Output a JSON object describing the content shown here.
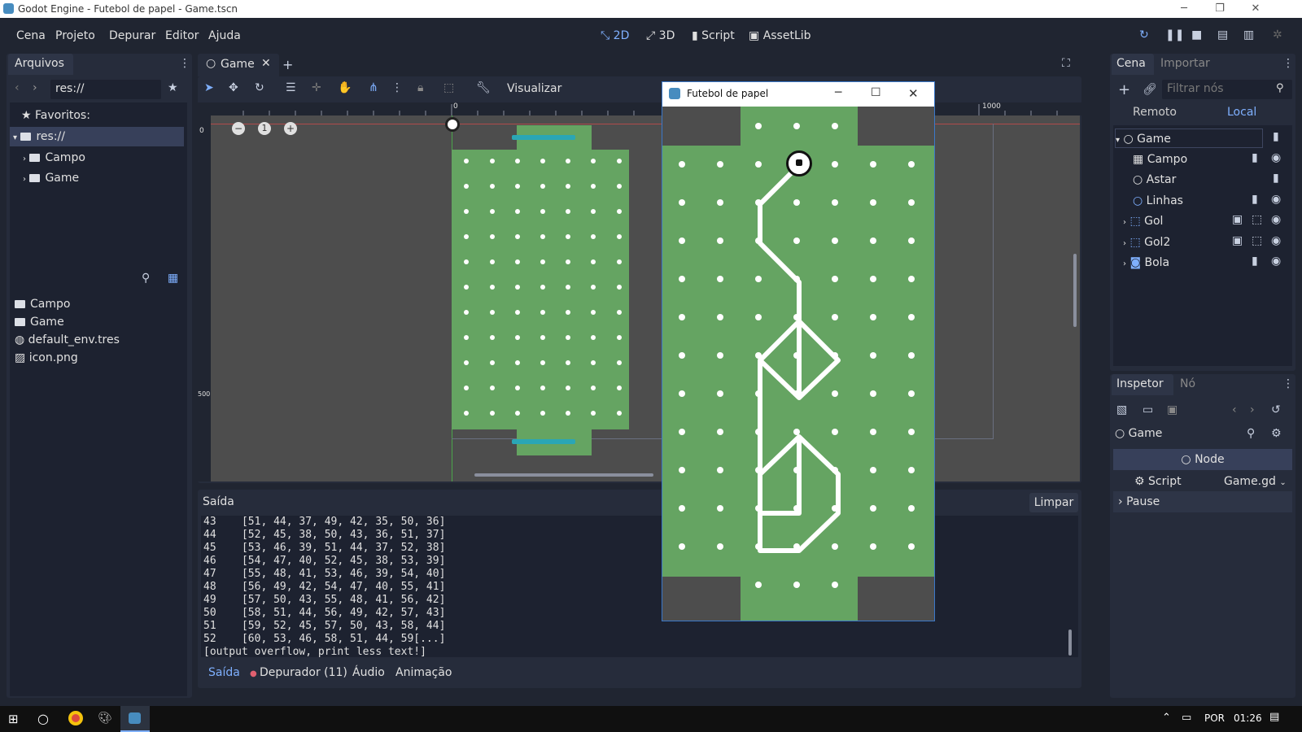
{
  "window": {
    "title": "Godot Engine - Futebol de papel - Game.tscn"
  },
  "menu": [
    "Cena",
    "Projeto",
    "Depurar",
    "Editor",
    "Ajuda"
  ],
  "modes": {
    "d2": "2D",
    "d3": "3D",
    "script": "Script",
    "assetlib": "AssetLib"
  },
  "filesystem": {
    "tab": "Arquivos",
    "path": "res://",
    "favorites": "Favoritos:",
    "tree": [
      "res://",
      "Campo",
      "Game"
    ],
    "files": [
      "Campo",
      "Game",
      "default_env.tres",
      "icon.png"
    ]
  },
  "viewport": {
    "tab": "Game",
    "view_menu": "Visualizar",
    "ruler": {
      "zero": "0",
      "thousand": "1000",
      "five_hundred": "500",
      "left_zero": "0"
    }
  },
  "game_window": {
    "title": "Futebol de papel"
  },
  "output": {
    "label": "Saída",
    "clear": "Limpar",
    "lines": [
      "43    [51, 44, 37, 49, 42, 35, 50, 36]",
      "44    [52, 45, 38, 50, 43, 36, 51, 37]",
      "45    [53, 46, 39, 51, 44, 37, 52, 38]",
      "46    [54, 47, 40, 52, 45, 38, 53, 39]",
      "47    [55, 48, 41, 53, 46, 39, 54, 40]",
      "48    [56, 49, 42, 54, 47, 40, 55, 41]",
      "49    [57, 50, 43, 55, 48, 41, 56, 42]",
      "50    [58, 51, 44, 56, 49, 42, 57, 43]",
      "51    [59, 52, 45, 57, 50, 43, 58, 44]",
      "52    [60, 53, 46, 58, 51, 44, 59[...]",
      "[output overflow, print less text!]"
    ],
    "tabs": {
      "saida": "Saída",
      "depurador": "Depurador (11)",
      "audio": "Áudio",
      "animacao": "Animação"
    }
  },
  "scene": {
    "tabs": {
      "cena": "Cena",
      "importar": "Importar"
    },
    "filter_placeholder": "Filtrar nós",
    "remote": "Remoto",
    "local": "Local",
    "nodes": [
      "Game",
      "Campo",
      "Astar",
      "Linhas",
      "Gol",
      "Gol2",
      "Bola"
    ]
  },
  "inspector": {
    "tabs": {
      "inspetor": "Inspetor",
      "no": "Nó"
    },
    "object": "Game",
    "node_section": "Node",
    "script_label": "Script",
    "script_value": "Game.gd",
    "pause": "Pause"
  },
  "taskbar": {
    "lang": "POR",
    "time": "01:26"
  },
  "colors": {
    "field": "#65a462",
    "accent": "#7fb0ff",
    "panel": "#262c3b",
    "bg": "#202531"
  }
}
